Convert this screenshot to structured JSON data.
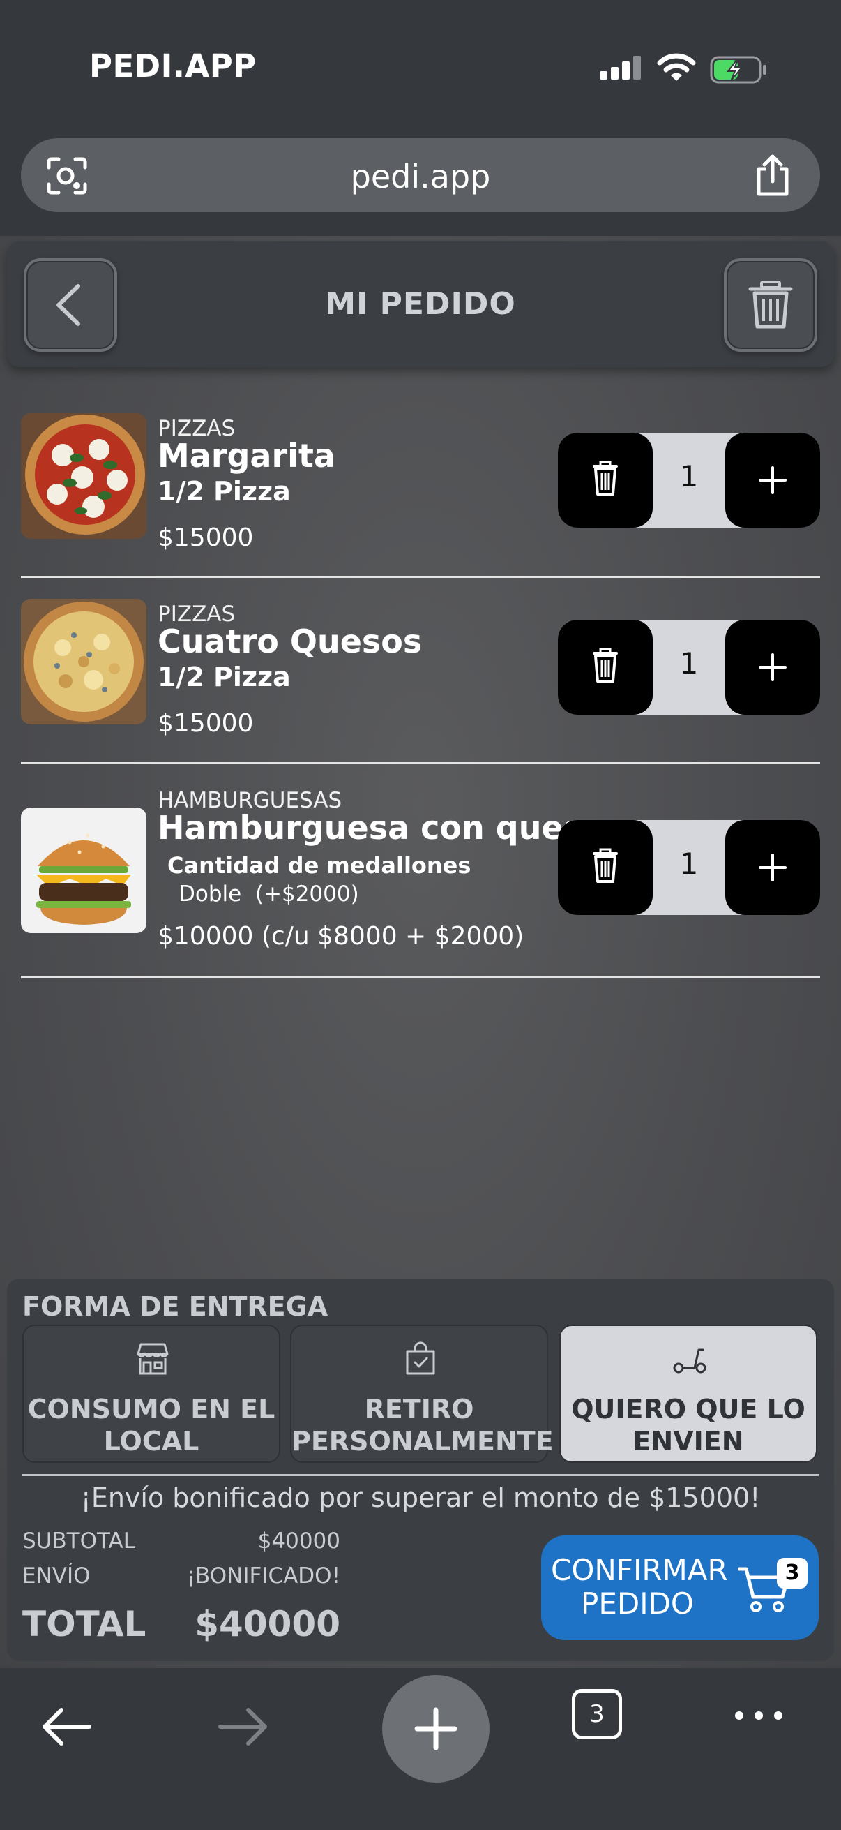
{
  "status_bar": {
    "carrier": "PEDI.APP"
  },
  "browser": {
    "url": "pedi.app",
    "tabs_count": "3"
  },
  "header": {
    "title": "MI PEDIDO"
  },
  "items": [
    {
      "category": "PIZZAS",
      "name": "Margarita",
      "variant": "1/2 Pizza",
      "price": "$15000",
      "quantity": "1"
    },
    {
      "category": "PIZZAS",
      "name": "Cuatro Quesos",
      "variant": "1/2 Pizza",
      "price": "$15000",
      "quantity": "1"
    },
    {
      "category": "HAMBURGUESAS",
      "name": "Hamburguesa con queso",
      "option_title": "Cantidad de medallones",
      "option_value": "Doble  (+$2000)",
      "price": "$10000 (c/u $8000 + $2000)",
      "quantity": "1"
    }
  ],
  "delivery": {
    "title": "FORMA DE ENTREGA",
    "options": [
      {
        "label": "CONSUMO EN EL LOCAL",
        "icon": "store-icon",
        "selected": false
      },
      {
        "label": "RETIRO PERSONALMENTE",
        "icon": "bag-icon",
        "selected": false
      },
      {
        "label": "QUIERO QUE LO ENVIEN",
        "icon": "scooter-icon",
        "selected": true
      }
    ]
  },
  "summary": {
    "promo": "¡Envío bonificado por superar el monto de $15000!",
    "subtotal_label": "SUBTOTAL",
    "subtotal_value": "$40000",
    "shipping_label": "ENVÍO",
    "shipping_value": "¡BONIFICADO!",
    "total_label": "TOTAL",
    "total_value": "$40000"
  },
  "confirm": {
    "label": "CONFIRMAR PEDIDO",
    "cart_count": "3"
  },
  "colors": {
    "accent": "#1f73c6",
    "panel": "#3b3e43",
    "selected": "#d5d7dc"
  }
}
